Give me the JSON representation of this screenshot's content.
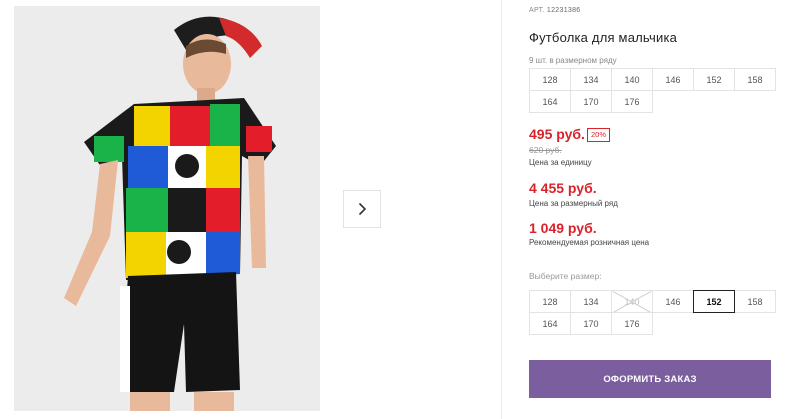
{
  "gallery": {
    "next_icon": "chevron-right-icon"
  },
  "product": {
    "art_label": "АРТ.",
    "art_value": "12231386",
    "title": "Футболка для мальчика",
    "row_label": "9 шт. в размерном ряду",
    "row_sizes": [
      "128",
      "134",
      "140",
      "146",
      "152",
      "158",
      "164",
      "170",
      "176"
    ]
  },
  "pricing": {
    "price": "495 руб.",
    "discount": "20%",
    "old_price": "620 руб.",
    "unit_caption": "Цена за единицу",
    "row_price": "4 455 руб.",
    "row_caption": "Цена за размерный ряд",
    "retail_price": "1 049 руб.",
    "retail_caption": "Рекомендуемая розничная цена",
    "accent_color": "#d8232a"
  },
  "size_select": {
    "label": "Выберите размер:",
    "sizes": [
      "128",
      "134",
      "140",
      "146",
      "152",
      "158",
      "164",
      "170",
      "176"
    ],
    "selected": "152",
    "unavailable": [
      "140"
    ]
  },
  "order": {
    "button_label": "ОФОРМИТЬ ЗАКАЗ",
    "button_color": "#7b5e9e"
  }
}
